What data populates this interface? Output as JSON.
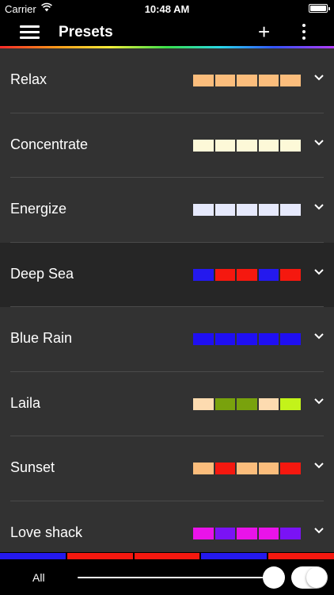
{
  "status_bar": {
    "carrier": "Carrier",
    "time": "10:48 AM",
    "wifi_icon": "wifi-icon",
    "battery_icon": "battery-icon",
    "battery_level": 1.0
  },
  "header": {
    "title": "Presets",
    "menu_icon": "hamburger-menu-icon",
    "add_icon": "plus-icon",
    "more_icon": "more-vertical-icon",
    "add_glyph": "+"
  },
  "presets": [
    {
      "name": "Relax",
      "colors": [
        "#fbbd7c",
        "#fbbd7c",
        "#fbbd7c",
        "#fbbd7c",
        "#fbbd7c"
      ],
      "selected": false
    },
    {
      "name": "Concentrate",
      "colors": [
        "#fdf9d8",
        "#fdf9d8",
        "#fdf9d8",
        "#fdf9d8",
        "#fdf9d8"
      ],
      "selected": false
    },
    {
      "name": "Energize",
      "colors": [
        "#e6e9fc",
        "#e6e9fc",
        "#e6e9fc",
        "#e6e9fc",
        "#e6e9fc"
      ],
      "selected": false
    },
    {
      "name": "Deep Sea",
      "colors": [
        "#2419ee",
        "#f5180f",
        "#f5180f",
        "#2419ee",
        "#f5180f"
      ],
      "selected": true
    },
    {
      "name": "Blue Rain",
      "colors": [
        "#1f0ff2",
        "#1f0ff2",
        "#1f0ff2",
        "#1f0ff2",
        "#1f0ff2"
      ],
      "selected": false
    },
    {
      "name": "Laila",
      "colors": [
        "#fddbb0",
        "#79a20d",
        "#79a20d",
        "#fddbb0",
        "#c3f31a"
      ],
      "selected": false
    },
    {
      "name": "Sunset",
      "colors": [
        "#fbbd7c",
        "#f5180f",
        "#fbbd7c",
        "#fbbd7c",
        "#f5180f"
      ],
      "selected": false
    },
    {
      "name": "Love shack",
      "colors": [
        "#e913e9",
        "#7a13f5",
        "#e913e9",
        "#e913e9",
        "#7a13f5"
      ],
      "selected": false
    }
  ],
  "chevron_icon": "chevron-down-icon",
  "bottom_colors": [
    "#2419ee",
    "#f5180f",
    "#f5180f",
    "#2419ee",
    "#f5180f"
  ],
  "bottom_bar": {
    "label": "All",
    "brightness": 1.0,
    "power_on": true
  },
  "colors": {
    "list_background": "#323232",
    "selected_row_background": "#262626",
    "bar_background": "#000000"
  }
}
